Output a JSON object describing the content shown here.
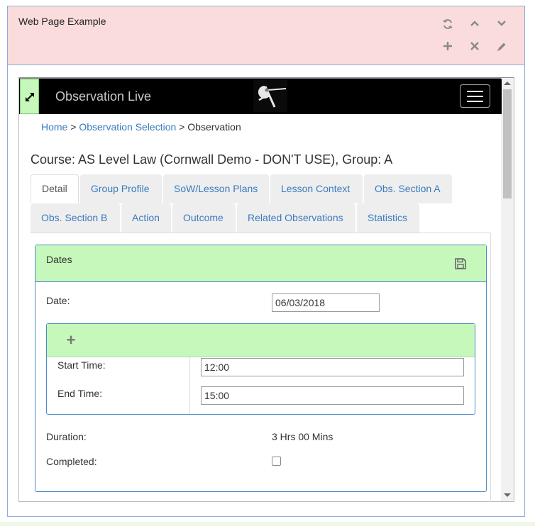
{
  "widget": {
    "title": "Web Page Example",
    "icons": [
      "refresh-icon",
      "chevron-up-icon",
      "chevron-down-icon",
      "plus-icon",
      "close-icon",
      "pencil-icon"
    ]
  },
  "navbar": {
    "brand": "Observation Live"
  },
  "breadcrumb": {
    "home": "Home",
    "separator": ">",
    "selection": "Observation Selection",
    "current": "Observation"
  },
  "course": {
    "title": "Course: AS Level Law (Cornwall Demo - DON'T USE), Group: A"
  },
  "tabs": {
    "detail": "Detail",
    "group_profile": "Group Profile",
    "sow": "SoW/Lesson Plans",
    "lesson_context": "Lesson Context",
    "obs_a": "Obs. Section A",
    "obs_b": "Obs. Section B",
    "action": "Action",
    "outcome": "Outcome",
    "related": "Related Observations",
    "statistics": "Statistics"
  },
  "dates_panel": {
    "title": "Dates",
    "date_label": "Date:",
    "date_value": "06/03/2018",
    "start_label": "Start Time:",
    "start_value": "12:00",
    "end_label": "End Time:",
    "end_value": "15:00",
    "duration_label": "Duration:",
    "duration_value": "3 Hrs 00 Mins",
    "completed_label": "Completed:",
    "completed_checked": false
  },
  "colors": {
    "widget_header": "#fbdcdc",
    "panel_heading": "#c6f7bb",
    "link": "#3a7bbf",
    "border_blue": "#4a8bc8"
  }
}
